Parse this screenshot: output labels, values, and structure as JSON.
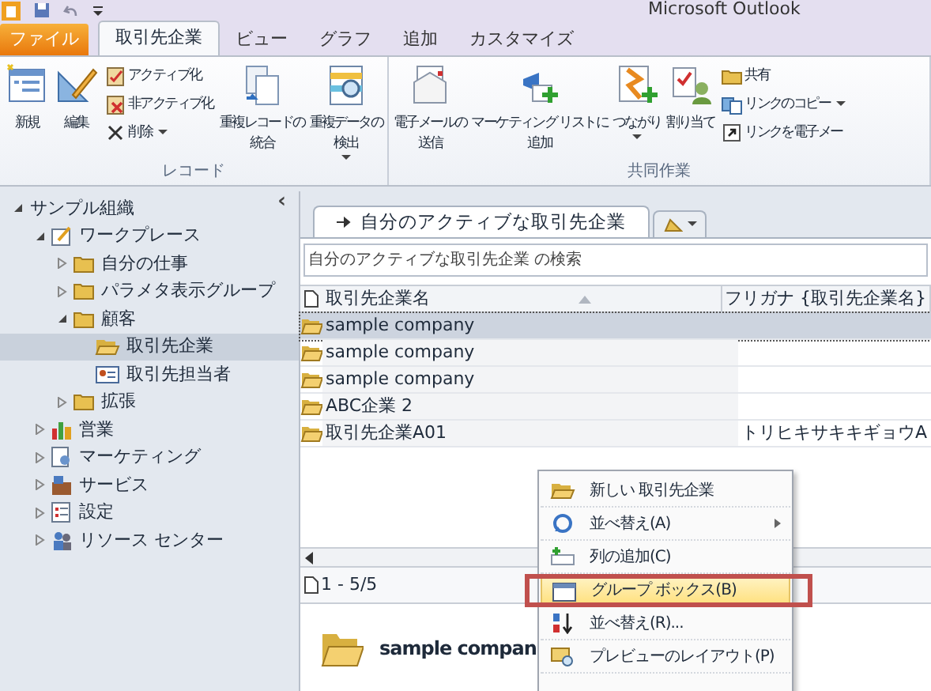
{
  "title_bar": {
    "title": "Microsoft Outlook"
  },
  "ribbon_tabs": [
    {
      "label": "ファイル",
      "kind": "file",
      "selected": false
    },
    {
      "label": "取引先企業",
      "kind": "tab",
      "selected": true
    },
    {
      "label": "ビュー",
      "kind": "tab",
      "selected": false
    },
    {
      "label": "グラフ",
      "kind": "tab",
      "selected": false
    },
    {
      "label": "追加",
      "kind": "tab",
      "selected": false
    },
    {
      "label": "カスタマイズ",
      "kind": "tab",
      "selected": false
    }
  ],
  "ribbon_groups": [
    {
      "label": "レコード",
      "items": [
        {
          "kind": "large",
          "lines": [
            "新規"
          ]
        },
        {
          "kind": "large",
          "lines": [
            "編集"
          ]
        },
        {
          "kind": "stack",
          "items": [
            {
              "label": "アクティブ化"
            },
            {
              "label": "非アクティブ化"
            },
            {
              "label": "削除",
              "dropdown": true
            }
          ]
        },
        {
          "kind": "large",
          "lines": [
            "重複レコードの",
            "統合"
          ]
        },
        {
          "kind": "large",
          "lines": [
            "重複データの",
            "検出"
          ],
          "dropdown": true
        }
      ]
    },
    {
      "label": "共同作業",
      "items": [
        {
          "kind": "large",
          "lines": [
            "電子メールの",
            "送信"
          ]
        },
        {
          "kind": "large",
          "lines": [
            "マーケティング リストに",
            "追加"
          ]
        },
        {
          "kind": "large",
          "lines": [
            "つながり"
          ],
          "dropdown": true
        },
        {
          "kind": "large",
          "lines": [
            "割り当て"
          ]
        },
        {
          "kind": "stack",
          "items": [
            {
              "label": "共有"
            },
            {
              "label": "リンクのコピー",
              "dropdown": true
            },
            {
              "label": "リンクを電子メー"
            }
          ]
        }
      ]
    }
  ],
  "navigation": {
    "collapse": "‹",
    "tree": [
      {
        "label": "サンプル組織",
        "expanded": true,
        "selected": false,
        "children": [
          {
            "label": "ワークプレース",
            "expanded": true,
            "selected": false,
            "children": [
              {
                "label": "自分の仕事",
                "expanded": false,
                "selected": false
              },
              {
                "label": "パラメタ表示グループ",
                "expanded": false,
                "selected": false
              },
              {
                "label": "顧客",
                "expanded": true,
                "selected": false,
                "children": [
                  {
                    "label": "取引先企業",
                    "selected": true
                  },
                  {
                    "label": "取引先担当者",
                    "selected": false
                  }
                ]
              },
              {
                "label": "拡張",
                "expanded": false,
                "selected": false
              }
            ]
          },
          {
            "label": "営業",
            "expanded": false,
            "selected": false
          },
          {
            "label": "マーケティング",
            "expanded": false,
            "selected": false
          },
          {
            "label": "サービス",
            "expanded": false,
            "selected": false
          },
          {
            "label": "設定",
            "expanded": false,
            "selected": false
          },
          {
            "label": "リソース センター",
            "expanded": false,
            "selected": false
          }
        ]
      }
    ]
  },
  "view": {
    "tabs": [
      {
        "label": "自分のアクティブな取引先企業",
        "selected": true
      }
    ],
    "search": {
      "placeholder": "自分のアクティブな取引先企業 の検索"
    },
    "table": {
      "columns": [
        "取引先企業名",
        "フリガナ {取引先企業名}"
      ],
      "rows": [
        {
          "cells": [
            "sample company",
            ""
          ],
          "selected": true
        },
        {
          "cells": [
            "sample company",
            ""
          ],
          "selected": false
        },
        {
          "cells": [
            "sample company",
            ""
          ],
          "selected": false
        },
        {
          "cells": [
            "ABC企業 2",
            ""
          ],
          "selected": false
        },
        {
          "cells": [
            "取引先企業A01",
            "トリヒキサキキギョウA"
          ],
          "selected": false
        }
      ]
    },
    "status": "1 - 5/5",
    "preview": {
      "title": "sample compan"
    }
  },
  "context_menu": {
    "items": [
      {
        "label": "新しい 取引先企業",
        "selected": false
      },
      {
        "label": "並べ替え(A)",
        "selected": false,
        "submenu": true
      },
      {
        "label": "列の追加(C)",
        "selected": false
      },
      {
        "label": "グループ ボックス(B)",
        "selected": true
      },
      {
        "label": "並べ替え(R)...",
        "selected": false
      },
      {
        "label": "プレビューのレイアウト(P)",
        "selected": false
      }
    ]
  }
}
